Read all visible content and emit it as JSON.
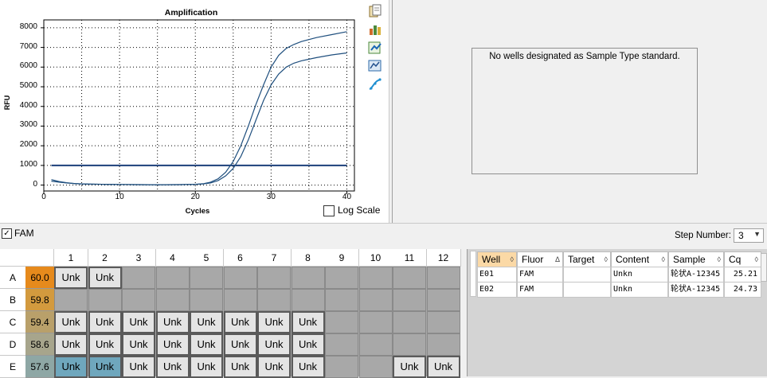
{
  "chart_data": {
    "type": "line",
    "title": "Amplification",
    "xlabel": "Cycles",
    "ylabel": "RFU",
    "xlim": [
      0,
      41
    ],
    "ylim": [
      -300,
      8400
    ],
    "xticks": [
      0,
      10,
      20,
      30,
      40
    ],
    "yticks": [
      0,
      1000,
      2000,
      3000,
      4000,
      5000,
      6000,
      7000,
      8000
    ],
    "grid": true,
    "threshold": 1000,
    "series": [
      {
        "x": [
          1,
          2,
          3,
          4,
          5,
          6,
          8,
          10,
          12,
          14,
          16,
          18,
          20,
          21,
          22,
          23,
          24,
          25,
          26,
          27,
          28,
          29,
          30,
          31,
          32,
          33,
          34,
          36,
          38,
          40
        ],
        "values": [
          200,
          150,
          110,
          80,
          60,
          50,
          40,
          30,
          25,
          20,
          20,
          25,
          40,
          70,
          150,
          320,
          650,
          1200,
          2000,
          3000,
          4100,
          5100,
          6000,
          6600,
          6950,
          7150,
          7300,
          7500,
          7650,
          7800
        ]
      },
      {
        "x": [
          1,
          2,
          3,
          4,
          5,
          6,
          8,
          10,
          12,
          14,
          16,
          18,
          20,
          21,
          22,
          23,
          24,
          25,
          26,
          27,
          28,
          29,
          30,
          31,
          32,
          33,
          34,
          36,
          38,
          40
        ],
        "values": [
          280,
          180,
          120,
          80,
          60,
          50,
          40,
          30,
          25,
          20,
          20,
          25,
          35,
          55,
          110,
          230,
          470,
          850,
          1450,
          2300,
          3300,
          4300,
          5100,
          5650,
          6000,
          6200,
          6320,
          6480,
          6620,
          6720
        ]
      }
    ]
  },
  "panel": {
    "log_scale_label": "Log Scale",
    "no_standards_message": "No wells designated as Sample Type standard."
  },
  "toolbar_icons": [
    "copy-icon",
    "export-icon",
    "export-chart-icon",
    "chart-settings-icon",
    "fit-curve-icon"
  ],
  "fluor_filter": {
    "label": "FAM",
    "checked": true
  },
  "step_number": {
    "label": "Step Number:",
    "value": "3"
  },
  "plate": {
    "columns": [
      "1",
      "2",
      "3",
      "4",
      "5",
      "6",
      "7",
      "8",
      "9",
      "10",
      "11",
      "12"
    ],
    "rows": [
      {
        "label": "A",
        "temp": "60.0",
        "temp_color": "#e68a1c",
        "wells": [
          "Unk",
          "Unk",
          "",
          "",
          "",
          "",
          "",
          "",
          "",
          "",
          "",
          ""
        ]
      },
      {
        "label": "B",
        "temp": "59.8",
        "temp_color": "#d39a3e",
        "wells": [
          "",
          "",
          "",
          "",
          "",
          "",
          "",
          "",
          "",
          "",
          "",
          ""
        ]
      },
      {
        "label": "C",
        "temp": "59.4",
        "temp_color": "#b9a06a",
        "wells": [
          "Unk",
          "Unk",
          "Unk",
          "Unk",
          "Unk",
          "Unk",
          "Unk",
          "Unk",
          "",
          "",
          "",
          ""
        ]
      },
      {
        "label": "D",
        "temp": "58.6",
        "temp_color": "#a7a58c",
        "wells": [
          "Unk",
          "Unk",
          "Unk",
          "Unk",
          "Unk",
          "Unk",
          "Unk",
          "Unk",
          "",
          "",
          "",
          ""
        ]
      },
      {
        "label": "E",
        "temp": "57.6",
        "temp_color": "#8ea7a5",
        "wells": [
          "Unk",
          "Unk",
          "Unk",
          "Unk",
          "Unk",
          "Unk",
          "Unk",
          "Unk",
          "",
          "",
          "Unk",
          "Unk"
        ]
      }
    ],
    "selected": [
      "E1",
      "E2"
    ]
  },
  "table": {
    "headers": [
      "Well",
      "Fluor",
      "Target",
      "Content",
      "Sample",
      "Cq"
    ],
    "rows": [
      [
        "E01",
        "FAM",
        "",
        "Unkn",
        "轮状A-12345",
        "25.21"
      ],
      [
        "E02",
        "FAM",
        "",
        "Unkn",
        "轮状A-12345",
        "24.73"
      ]
    ]
  }
}
